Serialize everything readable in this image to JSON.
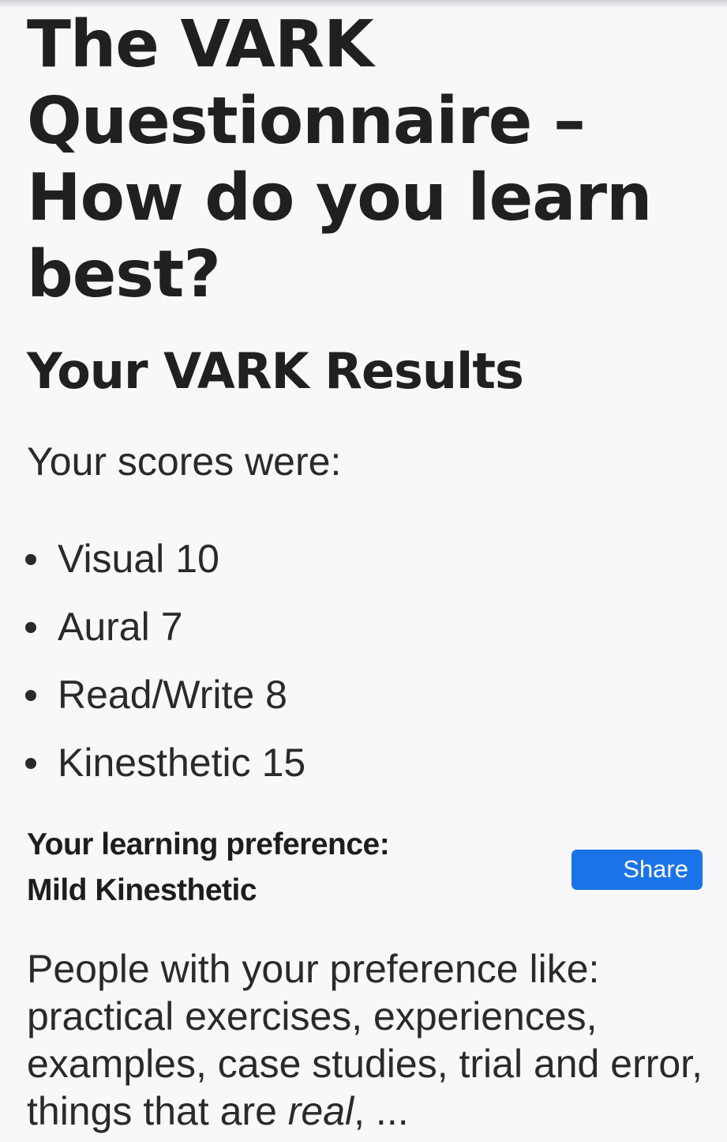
{
  "page": {
    "title": "The VARK Questionnaire – How do you learn best?",
    "section_title": "Your VARK Results",
    "scores_intro": "Your scores were:"
  },
  "scores": [
    {
      "label": "Visual",
      "value": "10"
    },
    {
      "label": "Aural",
      "value": "7"
    },
    {
      "label": "Read/Write",
      "value": "8"
    },
    {
      "label": "Kinesthetic",
      "value": "15"
    }
  ],
  "preference": {
    "label": "Your learning preference:",
    "value": "Mild Kinesthetic"
  },
  "share_button": {
    "label": "Share",
    "color": "#1a73e8"
  },
  "description": {
    "prefix": "People with your preference like: practical exercises, experiences, examples, case studies, trial and error, things that are ",
    "emphasis": "real",
    "suffix": ", ..."
  }
}
